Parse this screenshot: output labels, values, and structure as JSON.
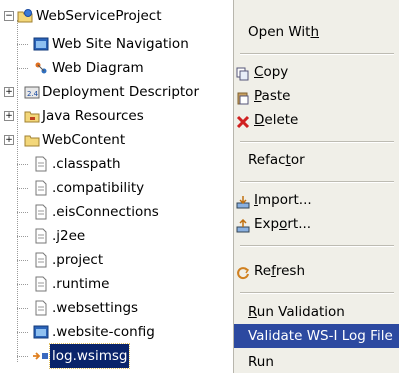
{
  "tree": {
    "root": {
      "label": "WebServiceProject",
      "expander": "−"
    },
    "items": [
      {
        "label": "Web Site Navigation",
        "icon": "site-navigation-icon"
      },
      {
        "label": "Web Diagram",
        "icon": "web-diagram-icon"
      },
      {
        "label": "Deployment Descriptor",
        "icon": "deployment-descriptor-icon",
        "expander": "+"
      },
      {
        "label": "Java Resources",
        "icon": "java-resources-icon",
        "expander": "+"
      },
      {
        "label": "WebContent",
        "icon": "folder-icon",
        "expander": "+"
      },
      {
        "label": ".classpath",
        "icon": "file-icon"
      },
      {
        "label": ".compatibility",
        "icon": "file-icon"
      },
      {
        "label": ".eisConnections",
        "icon": "file-icon"
      },
      {
        "label": ".j2ee",
        "icon": "file-icon"
      },
      {
        "label": ".project",
        "icon": "file-icon"
      },
      {
        "label": ".runtime",
        "icon": "file-icon"
      },
      {
        "label": ".websettings",
        "icon": "file-icon"
      },
      {
        "label": ".website-config",
        "icon": "website-config-icon"
      },
      {
        "label": "log.wsimsg",
        "icon": "wsimsg-icon",
        "selected": true
      }
    ]
  },
  "context_menu": {
    "open_with": {
      "pre": "Open Wit",
      "mn": "h",
      "post": ""
    },
    "copy": {
      "pre": "",
      "mn": "C",
      "post": "opy",
      "icon": "copy-icon"
    },
    "paste": {
      "pre": "",
      "mn": "P",
      "post": "aste",
      "icon": "paste-icon"
    },
    "delete": {
      "pre": "",
      "mn": "D",
      "post": "elete",
      "icon": "delete-icon"
    },
    "refactor": {
      "pre": "Refac",
      "mn": "t",
      "post": "or"
    },
    "import": {
      "pre": "",
      "mn": "I",
      "post": "mport...",
      "icon": "import-icon"
    },
    "export": {
      "pre": "Exp",
      "mn": "o",
      "post": "rt...",
      "icon": "export-icon"
    },
    "refresh": {
      "pre": "Re",
      "mn": "f",
      "post": "resh",
      "icon": "refresh-icon"
    },
    "run_validation": {
      "pre": "",
      "mn": "R",
      "post": "un Validation"
    },
    "validate_wsi": {
      "label": "Validate WS-I Log File"
    },
    "run": {
      "label": "Run"
    }
  },
  "colors": {
    "selection_bg": "#0a246a",
    "menu_highlight": "#2c49a0",
    "menu_bg": "#f0efe8"
  }
}
